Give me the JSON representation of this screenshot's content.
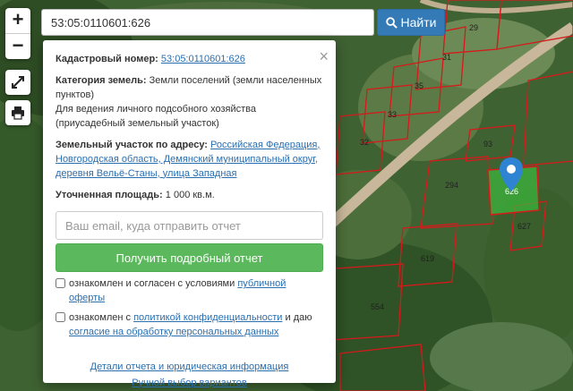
{
  "search": {
    "value": "53:05:0110601:626",
    "button_label": "Найти"
  },
  "map_controls": {
    "zoom_in": "+",
    "zoom_out": "−"
  },
  "popup": {
    "close": "×",
    "cadastral_label": "Кадастровый номер:",
    "cadastral_value": "53:05:0110601:626",
    "category_label": "Категория земель:",
    "category_value": "Земли поселений (земли населенных пунктов)",
    "usage": "Для ведения личного подсобного хозяйства (приусадебный земельный участок)",
    "address_label": "Земельный участок по адресу:",
    "address_value": "Российская Федерация, Новгородская область, Демянский муниципальный округ, деревня Вельё-Станы, улица Западная",
    "area_label": "Уточненная площадь:",
    "area_value": "1 000 кв.м.",
    "email_placeholder": "Ваш email, куда отправить отчет",
    "report_button": "Получить подробный отчет",
    "consent1_text": "ознакомлен и согласен с условиями",
    "consent1_link": "публичной оферты",
    "consent2_text": "ознакомлен с",
    "consent2_link": "политикой конфиденциальности",
    "consent2_text2": "и даю",
    "consent2_link2": "согласие на обработку персональных данных",
    "details_link": "Детали отчета и юридическая информация",
    "manual_link": "Ручной выбор вариантов"
  },
  "parcels": {
    "p29": "29",
    "p31": "31",
    "p35": "35",
    "p33": "33",
    "p32": "32",
    "p93": "93",
    "p294": "294",
    "p626": "626",
    "p627": "627",
    "p619": "619",
    "p554": "554"
  },
  "colors": {
    "accent": "#337ab7",
    "success": "#5cb85c",
    "boundary": "#d7191c",
    "selected": "#3cb43c"
  }
}
